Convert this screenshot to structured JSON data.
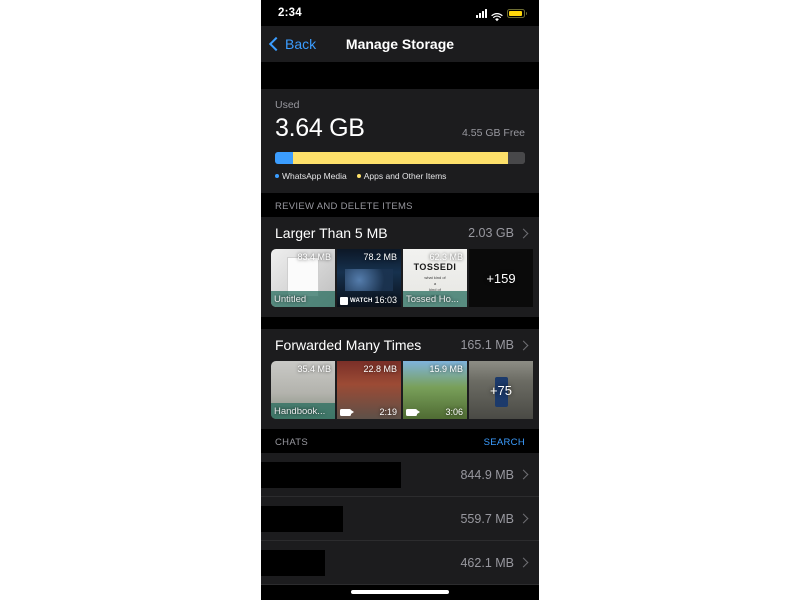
{
  "status_bar": {
    "time": "2:34",
    "signal_icon": "cellular-signal-icon",
    "wifi_icon": "wifi-icon",
    "battery_icon": "battery-low-power-icon"
  },
  "nav": {
    "back_label": "Back",
    "title": "Manage Storage"
  },
  "storage": {
    "used_label": "Used",
    "used_amount": "3.64 GB",
    "free_label": "4.55 GB Free",
    "legend": [
      {
        "label": "WhatsApp Media",
        "color": "#3b9dff"
      },
      {
        "label": "Apps and Other Items",
        "color": "#fde06a"
      }
    ],
    "bar": {
      "media_percent": 7,
      "apps_percent": 86,
      "free_percent": 7
    }
  },
  "review_section": {
    "header": "REVIEW AND DELETE ITEMS",
    "groups": [
      {
        "title": "Larger Than 5 MB",
        "size": "2.03 GB",
        "more_label": "+159",
        "items": [
          {
            "size": "83.4 MB",
            "caption": "Untitled",
            "duration": "",
            "kind": "document"
          },
          {
            "size": "78.2 MB",
            "caption": "",
            "duration": "16:03",
            "kind": "video",
            "badge": "WATCH"
          },
          {
            "size": "62.3 MB",
            "caption": "Tossed Ho...",
            "duration": "",
            "kind": "poster",
            "poster_title": "TOSSEDI"
          }
        ]
      },
      {
        "title": "Forwarded Many Times",
        "size": "165.1 MB",
        "more_label": "+75",
        "items": [
          {
            "size": "35.4 MB",
            "caption": "Handbook...",
            "duration": "",
            "kind": "photo"
          },
          {
            "size": "22.8 MB",
            "caption": "",
            "duration": "2:19",
            "kind": "video"
          },
          {
            "size": "15.9 MB",
            "caption": "",
            "duration": "3:06",
            "kind": "video"
          }
        ]
      }
    ]
  },
  "chats_section": {
    "header": "CHATS",
    "search_label": "SEARCH",
    "rows": [
      {
        "name": "",
        "size": "844.9 MB",
        "redact_width": 140
      },
      {
        "name": "",
        "size": "559.7 MB",
        "redact_width": 82
      },
      {
        "name": "",
        "size": "462.1 MB",
        "redact_width": 64
      }
    ]
  }
}
